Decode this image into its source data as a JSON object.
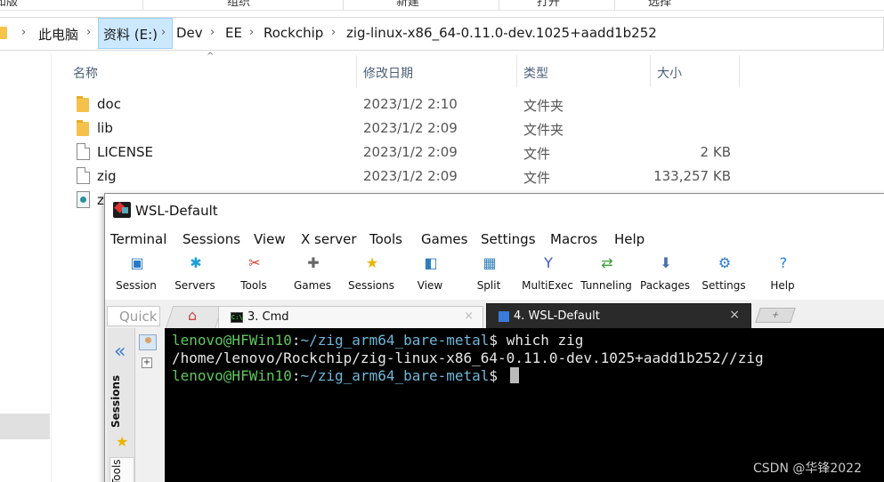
{
  "explorer": {
    "ribbon_cut_labels": [
      "知版",
      "组织",
      "新建",
      "打开",
      "选择"
    ],
    "breadcrumb": [
      "此电脑",
      "资料 (E:)",
      "Dev",
      "EE",
      "Rockchip",
      "zig-linux-x86_64-0.11.0-dev.1025+aadd1b252"
    ],
    "columns": {
      "name": "名称",
      "date": "修改日期",
      "type": "类型",
      "size": "大小"
    },
    "files": [
      {
        "name": "doc",
        "date": "2023/1/2 2:10",
        "type": "文件夹",
        "size": "",
        "icon": "folder-icon"
      },
      {
        "name": "lib",
        "date": "2023/1/2 2:09",
        "type": "文件夹",
        "size": "",
        "icon": "folder-icon"
      },
      {
        "name": "LICENSE",
        "date": "2023/1/2 2:09",
        "type": "文件",
        "size": "2 KB",
        "icon": "file-icon"
      },
      {
        "name": "zig",
        "date": "2023/1/2 2:09",
        "type": "文件",
        "size": "133,257 KB",
        "icon": "file-icon"
      }
    ],
    "partial_row_name": "z"
  },
  "moba": {
    "title": "WSL-Default",
    "menu": [
      "Terminal",
      "Sessions",
      "View",
      "X server",
      "Tools",
      "Games",
      "Settings",
      "Macros",
      "Help"
    ],
    "toolbar": [
      {
        "label": "Session",
        "icon": "session-icon",
        "color": "#2b78c6",
        "glyph": "▣"
      },
      {
        "label": "Servers",
        "icon": "servers-icon",
        "color": "#1aa0d8",
        "glyph": "✱"
      },
      {
        "label": "Tools",
        "icon": "tools-icon",
        "color": "#d23b2b",
        "glyph": "✂"
      },
      {
        "label": "Games",
        "icon": "games-icon",
        "color": "#666666",
        "glyph": "✚"
      },
      {
        "label": "Sessions",
        "icon": "star-icon",
        "color": "#e8b400",
        "glyph": "★"
      },
      {
        "label": "View",
        "icon": "view-icon",
        "color": "#2f7fb8",
        "glyph": "◧"
      },
      {
        "label": "Split",
        "icon": "split-icon",
        "color": "#2f7fb8",
        "glyph": "▦"
      },
      {
        "label": "MultiExec",
        "icon": "multiexec-icon",
        "color": "#3b55c9",
        "glyph": "Y"
      },
      {
        "label": "Tunneling",
        "icon": "tunneling-icon",
        "color": "#3a9b3a",
        "glyph": "⇄"
      },
      {
        "label": "Packages",
        "icon": "packages-icon",
        "color": "#4a6fa8",
        "glyph": "⬇"
      },
      {
        "label": "Settings",
        "icon": "settings-icon",
        "color": "#2b78c6",
        "glyph": "⚙"
      },
      {
        "label": "Help",
        "icon": "help-icon",
        "color": "#1e7fe0",
        "glyph": "?"
      }
    ],
    "quick_placeholder": "Quick",
    "tabs": [
      {
        "label": "3. Cmd",
        "close": "×"
      },
      {
        "label": "4. WSL-Default",
        "close": "×"
      }
    ],
    "side": {
      "sessions_label": "Sessions",
      "tools_label": "Tools"
    },
    "terminal": {
      "lines": [
        {
          "user": "lenovo@HFWin10",
          "sep": ":",
          "path": "~/zig_arm64_bare-metal",
          "prompt": "$ ",
          "cmd": "which zig"
        },
        {
          "output": "/home/lenovo/Rockchip/zig-linux-x86_64-0.11.0-dev.1025+aadd1b252//zig"
        },
        {
          "user": "lenovo@HFWin10",
          "sep": ":",
          "path": "~/zig_arm64_bare-metal",
          "prompt": "$ ",
          "cmd": ""
        }
      ]
    }
  },
  "watermark": "CSDN @华锋2022"
}
